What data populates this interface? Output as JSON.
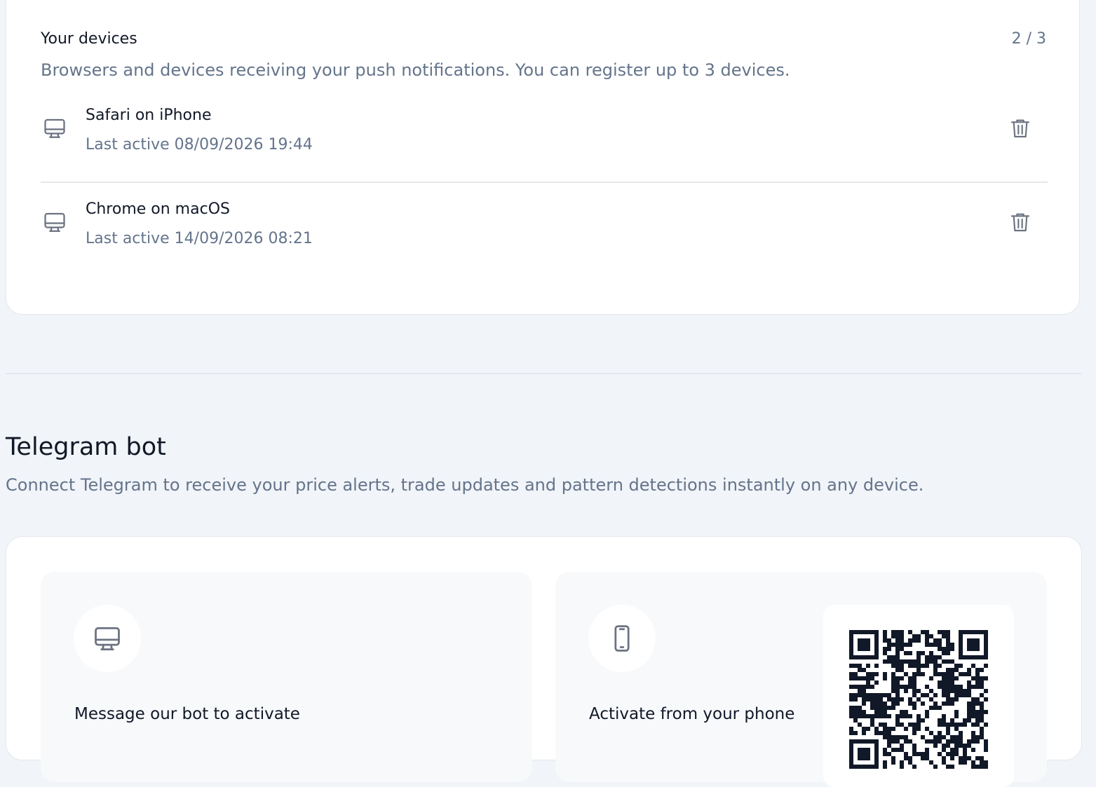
{
  "devices": {
    "title": "Your devices",
    "count": "2 / 3",
    "description": "Browsers and devices receiving your push notifications. You can register up to 3 devices.",
    "items": [
      {
        "name": "Safari on iPhone",
        "last_active": "Last active 08/09/2026 19:44",
        "icon": "monitor-icon"
      },
      {
        "name": "Chrome on macOS",
        "last_active": "Last active 14/09/2026 08:21",
        "icon": "monitor-icon"
      }
    ]
  },
  "telegram": {
    "title": "Telegram bot",
    "description": "Connect Telegram to receive your price alerts, trade updates and pattern detections instantly on any device.",
    "options": [
      {
        "title": "Message our bot to activate",
        "icon": "monitor-icon"
      },
      {
        "title": "Activate from your phone",
        "icon": "smartphone-icon"
      }
    ]
  },
  "colors": {
    "background": "#f1f4f8",
    "card": "#ffffff",
    "muted_text": "#64748b",
    "icon_stroke": "#6b7280"
  }
}
